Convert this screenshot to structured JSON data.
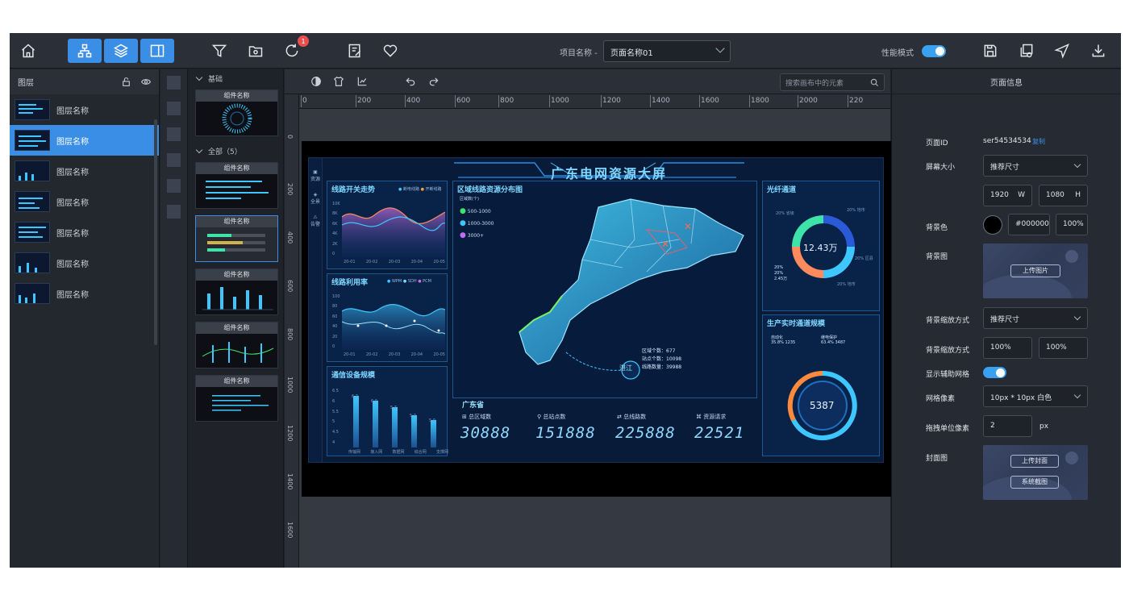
{
  "topbar": {
    "notification_count": "1",
    "project_label": "项目名称 -",
    "page_select_value": "页面名称01",
    "perf_mode_label": "性能模式"
  },
  "layers": {
    "title": "图层",
    "items": [
      {
        "label": "图层名称"
      },
      {
        "label": "图层名称"
      },
      {
        "label": "图层名称"
      },
      {
        "label": "图层名称"
      },
      {
        "label": "图层名称"
      },
      {
        "label": "图层名称"
      },
      {
        "label": "图层名称"
      }
    ]
  },
  "components": {
    "group_basic": "基础",
    "group_all": "全部（5）",
    "item_label": "组件名称"
  },
  "canvas": {
    "search_placeholder": "搜索画布中的元素",
    "ruler_h": [
      "0",
      "200",
      "400",
      "600",
      "800",
      "1000",
      "1200",
      "1400",
      "1600",
      "1800",
      "2000",
      "220"
    ],
    "ruler_v": [
      "0",
      "200",
      "400",
      "600",
      "800",
      "1000",
      "1200",
      "1400",
      "1600"
    ]
  },
  "screen": {
    "title": "广东电网资源大屏",
    "nav": [
      "资源",
      "全景",
      "告警"
    ],
    "panel1": {
      "title": "线路开关走势",
      "legend": [
        "断电线路",
        "开断线路"
      ],
      "x": [
        "20-01",
        "20-02",
        "20-03",
        "20-04",
        "20-05"
      ],
      "y": [
        "10K",
        "8K",
        "6K",
        "4K",
        "2K",
        "0"
      ]
    },
    "panel2": {
      "title": "线路利用率",
      "legend": [
        "WPM",
        "SDH",
        "PCM"
      ],
      "x": [
        "20-01",
        "20-02",
        "20-03",
        "20-04",
        "20-05"
      ],
      "y": [
        "100",
        "80",
        "60",
        "40",
        "20",
        "0"
      ]
    },
    "panel3": {
      "title": "通信设备规模",
      "y": [
        "6.5",
        "6",
        "5.5",
        "5",
        "4.5",
        "4"
      ],
      "x": [
        "传输网",
        "接入网",
        "数据网",
        "综合网",
        "支撑网"
      ],
      "values": [
        "6.2",
        "6.0",
        "5.7",
        "5.2",
        "5.0"
      ]
    },
    "map": {
      "title": "区域线路资源分布图",
      "unit": "区域数(个)",
      "legend": [
        "500-1000",
        "1000-3000",
        "3000+"
      ],
      "legend_colors": [
        "#3de36a",
        "#3ec7ff",
        "#c46cf0"
      ],
      "city": "湛江",
      "city_stats": [
        "区域个数：677",
        "站点个数：10098",
        "线路数量：39988"
      ],
      "province": "广东省"
    },
    "stats": [
      {
        "label": "总区域数",
        "value": "30888"
      },
      {
        "label": "总站点数",
        "value": "151888"
      },
      {
        "label": "总线路数",
        "value": "225888"
      },
      {
        "label": "资源请求",
        "value": "22521"
      }
    ],
    "fiber": {
      "title": "光纤通道",
      "center": "12.43万",
      "annotations": [
        "20% 省级",
        "20% 地市",
        "20% 区县",
        "20% 地市",
        "20%",
        "20%",
        "2.45万"
      ]
    },
    "prod": {
      "title": "生产实时通道规模",
      "labels": [
        "自动化",
        "继电保护"
      ],
      "sub": [
        "35.8%  1235",
        "63.4%  3487"
      ],
      "center": "5387"
    }
  },
  "props": {
    "title": "页面信息",
    "page_id_label": "页面ID",
    "page_id_value": "ser54534534",
    "copy_label": "复制",
    "screen_size_label": "屏幕大小",
    "screen_size_value": "推荐尺寸",
    "width_value": "1920",
    "width_unit": "W",
    "height_value": "1080",
    "height_unit": "H",
    "bg_color_label": "背景色",
    "bg_color_value": "#000000",
    "bg_opacity_value": "100%",
    "bg_image_label": "背景图",
    "upload_image_label": "上传图片",
    "bg_scale_label": "背景缩放方式",
    "bg_scale_value": "推荐尺寸",
    "bg_scale2_label": "背景缩放方式",
    "bg_scale_w": "100%",
    "bg_scale_h": "100%",
    "grid_label": "显示辅助网格",
    "grid_px_label": "网格像素",
    "grid_px_value": "10px * 10px  白色",
    "drag_unit_label": "拖拽单位像素",
    "drag_unit_value": "2",
    "drag_unit_suffix": "px",
    "cover_label": "封面图",
    "upload_cover_label": "上传封面",
    "screenshot_label": "系统截图"
  },
  "colors": {
    "accent": "#3a8ee6",
    "panel_bg": "#262b33",
    "screen_bg": "#081b39"
  }
}
